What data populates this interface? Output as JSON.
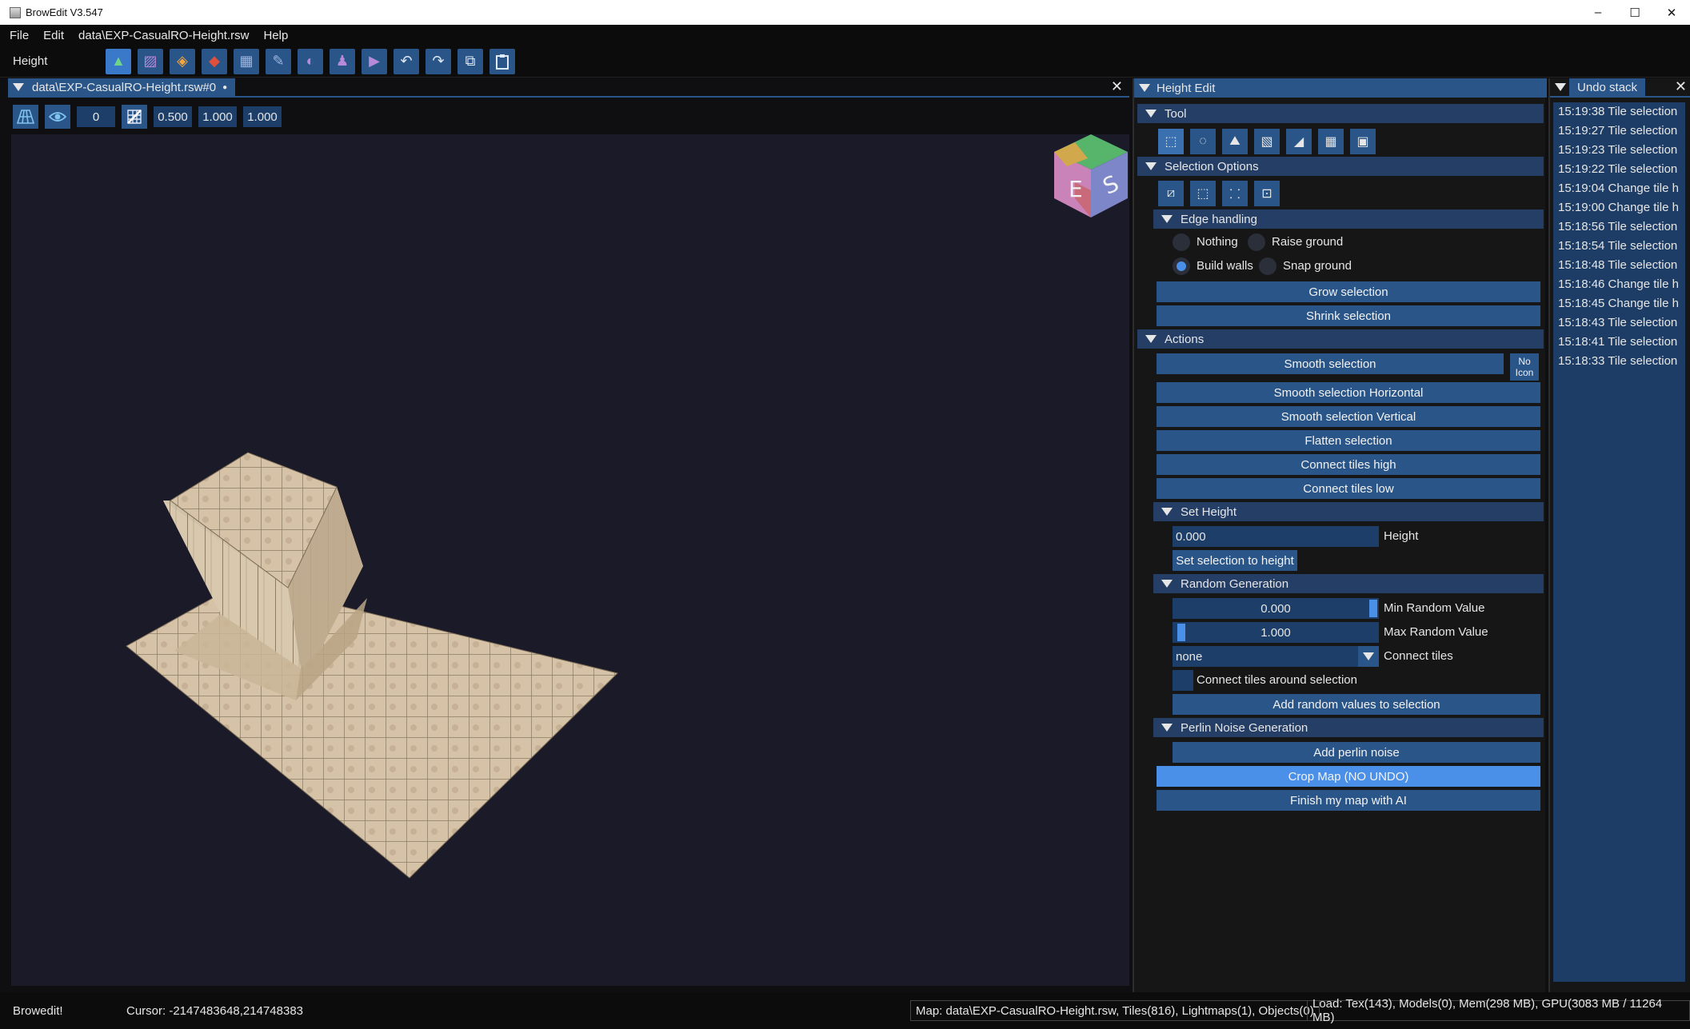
{
  "window": {
    "title": "BrowEdit V3.547",
    "controls": [
      "–",
      "☐",
      "✕"
    ]
  },
  "menu": [
    "File",
    "Edit",
    "data\\EXP-CasualRO-Height.rsw",
    "Help"
  ],
  "toolbar": {
    "mode_label": "Height",
    "icons": [
      "height-mode-icon",
      "texture-mode-icon",
      "object-mode-icon",
      "wall-mode-icon",
      "gat-mode-icon",
      "wall-edit-icon",
      "light-icon",
      "sprite-icon",
      "camera-icon",
      "undo-icon",
      "redo-icon",
      "copy-icon",
      "paste-icon"
    ],
    "glyphs": [
      "▲",
      "▨",
      "◈",
      "◆",
      "▦",
      "✎",
      "◐",
      "♟",
      "▶",
      "↶",
      "↷",
      "⧉",
      "📋"
    ]
  },
  "viewport": {
    "tab_label": "data\\EXP-CasualRO-Height.rsw#0",
    "tab_marker": "●",
    "close": "✕",
    "grid_value": "0",
    "field1": "0.500",
    "field2": "1.000",
    "field3": "1.000",
    "gizmo_labels": [
      "E",
      "S"
    ]
  },
  "height_edit": {
    "title": "Height Edit",
    "tool_section": "Tool",
    "tool_glyphs": [
      "⬚",
      "◌",
      "⛰",
      "▧",
      "◢",
      "▦",
      "▣"
    ],
    "selection_options": "Selection Options",
    "sel_glyphs": [
      "⧄",
      "⬚",
      "⸬",
      "⊡"
    ],
    "edge_handling": "Edge handling",
    "edge_options": {
      "nothing": "Nothing",
      "raise": "Raise ground",
      "walls": "Build walls",
      "snap": "Snap ground"
    },
    "grow": "Grow selection",
    "shrink": "Shrink selection",
    "actions": "Actions",
    "smooth": "Smooth selection",
    "no_icon_1": "No",
    "no_icon_2": "Icon",
    "smooth_h": "Smooth selection Horizontal",
    "smooth_v": "Smooth selection Vertical",
    "flatten": "Flatten selection",
    "connect_high": "Connect tiles high",
    "connect_low": "Connect tiles low",
    "set_height_section": "Set Height",
    "height_value": "0.000",
    "height_label": "Height",
    "set_to_height": "Set selection to height",
    "random_section": "Random Generation",
    "min_value": "0.000",
    "min_label": "Min Random Value",
    "max_value": "1.000",
    "max_label": "Max Random Value",
    "connect_select": "none",
    "connect_label": "Connect tiles",
    "connect_around": "Connect tiles around selection",
    "add_random": "Add random values to selection",
    "perlin_section": "Perlin Noise Generation",
    "add_perlin": "Add perlin noise",
    "crop": "Crop Map (NO UNDO)",
    "finish_ai": "Finish my map with AI"
  },
  "undo_stack": {
    "title": "Undo stack",
    "close": "✕",
    "items": [
      "15:19:38 Tile selection",
      "15:19:27 Tile selection",
      "15:19:23 Tile selection",
      "15:19:22 Tile selection",
      "15:19:04 Change tile h",
      "15:19:00 Change tile h",
      "15:18:56 Tile selection",
      "15:18:54 Tile selection",
      "15:18:48 Tile selection",
      "15:18:46 Change tile h",
      "15:18:45 Change tile h",
      "15:18:43 Tile selection",
      "15:18:41 Tile selection",
      "15:18:33 Tile selection"
    ]
  },
  "status": {
    "app": "Browedit!",
    "cursor": "Cursor: -2147483648,214748383",
    "map": "Map: data\\EXP-CasualRO-Height.rsw, Tiles(816), Lightmaps(1), Objects(0)",
    "load": "Load: Tex(143), Models(0), Mem(298 MB), GPU(3083 MB / 11264 MB)"
  },
  "colors": {
    "accent": "#2a5588",
    "highlight": "#4a90e8",
    "viewport_bg": "#1a1a28"
  }
}
